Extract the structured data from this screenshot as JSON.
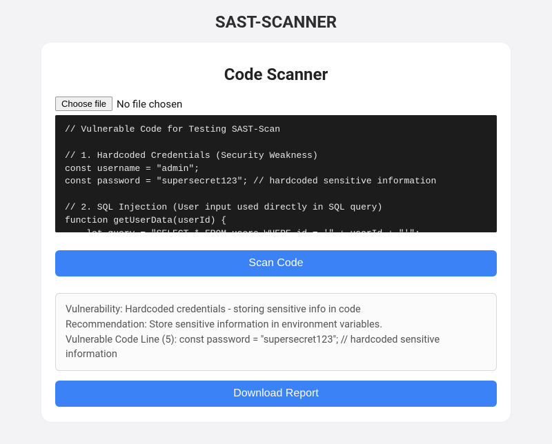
{
  "app_title": "SAST-SCANNER",
  "card": {
    "title": "Code Scanner",
    "file_button": "Choose file",
    "file_status": "No file chosen",
    "code": "// Vulnerable Code for Testing SAST-Scan\n\n// 1. Hardcoded Credentials (Security Weakness)\nconst username = \"admin\";\nconst password = \"supersecret123\"; // hardcoded sensitive information\n\n// 2. SQL Injection (User input used directly in SQL query)\nfunction getUserData(userId) {\n    let query = \"SELECT * FROM users WHERE id = '\" + userId + \"'\";",
    "scan_button": "Scan Code",
    "download_button": "Download Report"
  },
  "report": {
    "vulnerability": "Vulnerability: Hardcoded credentials - storing sensitive info in code",
    "recommendation": "Recommendation: Store sensitive information in environment variables.",
    "code_line": "Vulnerable Code Line (5): const password = \"supersecret123\"; // hardcoded sensitive information"
  },
  "colors": {
    "primary": "#3b82f6",
    "background": "#f3f3f5",
    "card_bg": "#ffffff",
    "code_bg": "#1c1c1c"
  }
}
